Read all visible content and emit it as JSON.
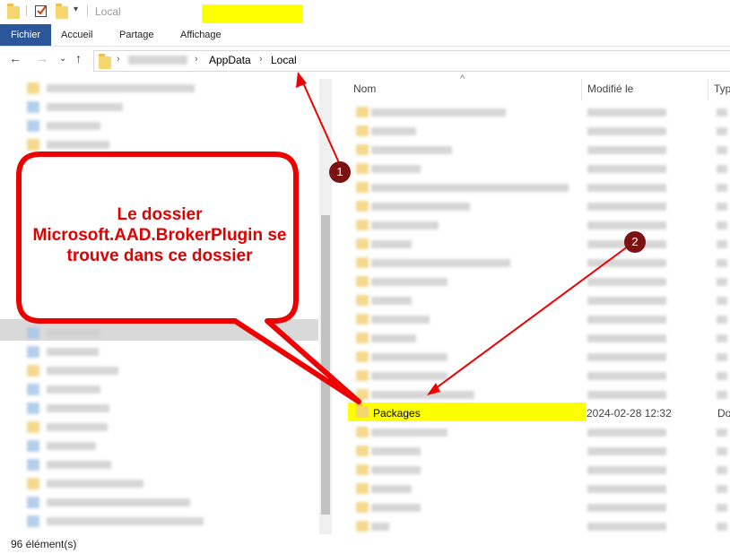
{
  "window": {
    "title": "Local"
  },
  "ribbon": {
    "tabs": [
      "Fichier",
      "Accueil",
      "Partage",
      "Affichage"
    ]
  },
  "address": {
    "crumbs": [
      "AppData",
      "Local"
    ]
  },
  "columns": {
    "name": "Nom",
    "modified": "Modifié le",
    "type": "Typ"
  },
  "highlighted_row": {
    "name": "Packages",
    "modified": "2024-02-28 12:32",
    "type": "Do"
  },
  "status": {
    "items": "96 élément(s)"
  },
  "annotation": {
    "callout_text": "Le dossier Microsoft.AAD.BrokerPlugin se trouve dans ce dossier",
    "marker1": "1",
    "marker2": "2"
  },
  "colors": {
    "highlight": "#ffff00",
    "annotation_red": "#e00000",
    "marker": "#7b1212",
    "file_tab": "#2b579a",
    "folder": "#f6d76f"
  },
  "icons": [
    "folder-icon",
    "checkbox-icon",
    "dropdown-icon",
    "back-arrow-icon",
    "forward-arrow-icon",
    "recent-chevron-icon",
    "up-arrow-icon",
    "sort-up-icon"
  ]
}
